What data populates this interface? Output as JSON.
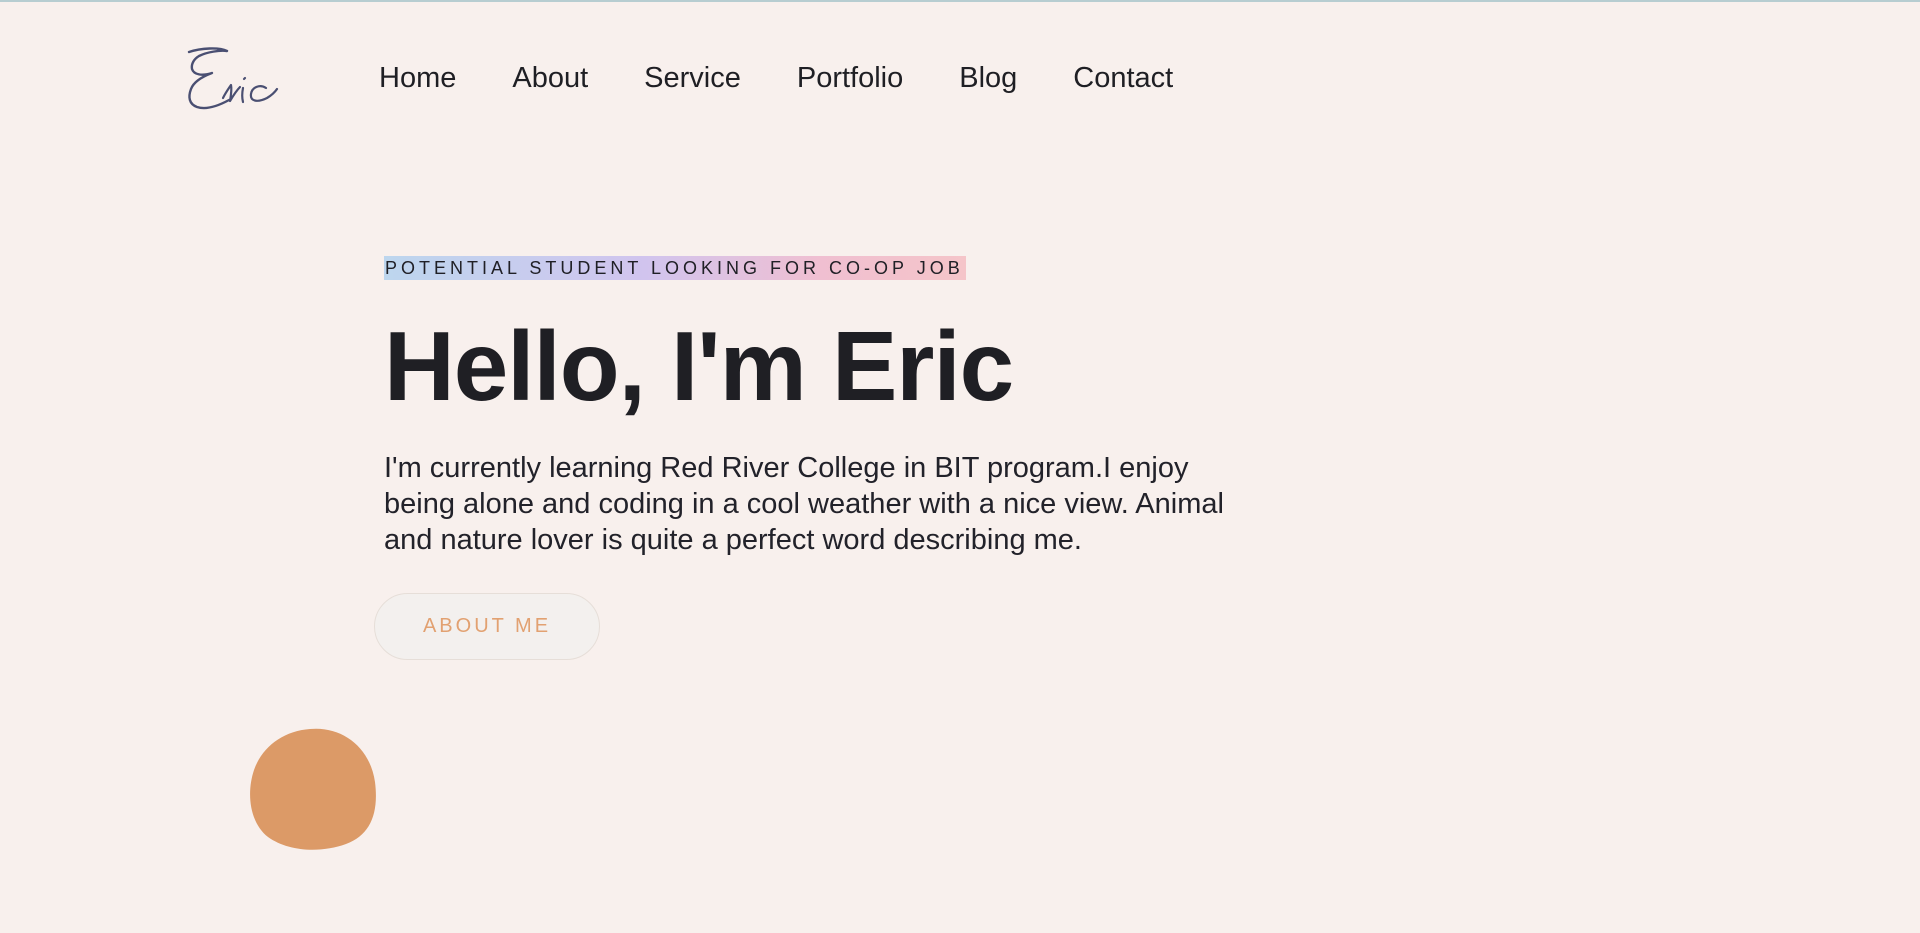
{
  "site": {
    "logo_text": "Eric",
    "nav": [
      {
        "label": "Home"
      },
      {
        "label": "About"
      },
      {
        "label": "Service"
      },
      {
        "label": "Portfolio"
      },
      {
        "label": "Blog"
      },
      {
        "label": "Contact"
      }
    ]
  },
  "hero": {
    "eyebrow": "POTENTIAL STUDENT LOOKING FOR CO-OP JOB",
    "title": "Hello, I'm Eric",
    "description": "I'm currently learning Red River College in BIT program.I enjoy being alone and coding in a cool weather with a nice view. Animal and nature lover is quite a perfect word describing me.",
    "button_label": "ABOUT ME"
  },
  "colors": {
    "background": "#f8f0ed",
    "text": "#1f1f24",
    "button_text": "#e2a171",
    "blob": "#dc9a67",
    "logo": "#4a4f72"
  },
  "icons": {
    "logo": "eric-signature-logo",
    "decoration": "orange-blob-shape"
  }
}
